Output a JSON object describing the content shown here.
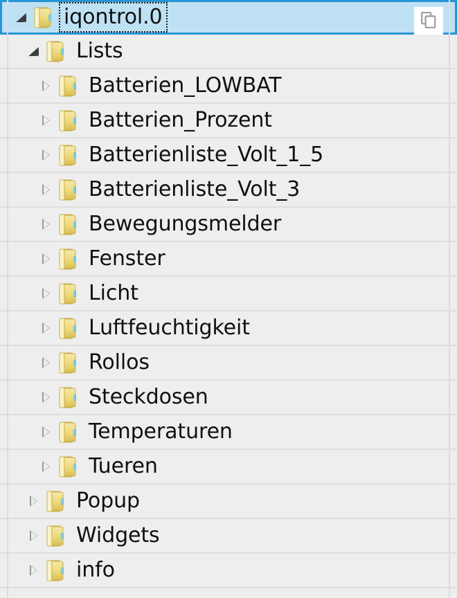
{
  "theme": {
    "row_background": "#eeeeee",
    "row_separator": "#dedede",
    "selection_fill": "#bfe1f4",
    "selection_border": "#2595d3",
    "folder_color": "#e8d36a",
    "text_color": "#101010",
    "arrow_collapsed_color": "#9a9a9a",
    "arrow_expanded_color": "#3d3d3d"
  },
  "tree": {
    "selected_row_index": 0,
    "rows": [
      {
        "label": "iqontrol.0",
        "level": 1,
        "state": "expanded",
        "selected": true,
        "focused": true,
        "has_copy_button": true
      },
      {
        "label": "Lists",
        "level": 2,
        "state": "expanded",
        "selected": false,
        "focused": false,
        "has_copy_button": false
      },
      {
        "label": "Batterien_LOWBAT",
        "level": 3,
        "state": "collapsed",
        "selected": false,
        "focused": false,
        "has_copy_button": false
      },
      {
        "label": "Batterien_Prozent",
        "level": 3,
        "state": "collapsed",
        "selected": false,
        "focused": false,
        "has_copy_button": false
      },
      {
        "label": "Batterienliste_Volt_1_5",
        "level": 3,
        "state": "collapsed",
        "selected": false,
        "focused": false,
        "has_copy_button": false
      },
      {
        "label": "Batterienliste_Volt_3",
        "level": 3,
        "state": "collapsed",
        "selected": false,
        "focused": false,
        "has_copy_button": false
      },
      {
        "label": "Bewegungsmelder",
        "level": 3,
        "state": "collapsed",
        "selected": false,
        "focused": false,
        "has_copy_button": false
      },
      {
        "label": "Fenster",
        "level": 3,
        "state": "collapsed",
        "selected": false,
        "focused": false,
        "has_copy_button": false
      },
      {
        "label": "Licht",
        "level": 3,
        "state": "collapsed",
        "selected": false,
        "focused": false,
        "has_copy_button": false
      },
      {
        "label": "Luftfeuchtigkeit",
        "level": 3,
        "state": "collapsed",
        "selected": false,
        "focused": false,
        "has_copy_button": false
      },
      {
        "label": "Rollos",
        "level": 3,
        "state": "collapsed",
        "selected": false,
        "focused": false,
        "has_copy_button": false
      },
      {
        "label": "Steckdosen",
        "level": 3,
        "state": "collapsed",
        "selected": false,
        "focused": false,
        "has_copy_button": false
      },
      {
        "label": "Temperaturen",
        "level": 3,
        "state": "collapsed",
        "selected": false,
        "focused": false,
        "has_copy_button": false
      },
      {
        "label": "Tueren",
        "level": 3,
        "state": "collapsed",
        "selected": false,
        "focused": false,
        "has_copy_button": false
      },
      {
        "label": "Popup",
        "level": 2,
        "state": "collapsed",
        "selected": false,
        "focused": false,
        "has_copy_button": false
      },
      {
        "label": "Widgets",
        "level": 2,
        "state": "collapsed",
        "selected": false,
        "focused": false,
        "has_copy_button": false
      },
      {
        "label": "info",
        "level": 2,
        "state": "collapsed",
        "selected": false,
        "focused": false,
        "has_copy_button": false
      }
    ]
  },
  "icons": {
    "folder": "folder-icon",
    "copy": "copy-icon",
    "expand_collapsed": "chevron-right-icon",
    "expand_expanded": "chevron-down-icon"
  },
  "copy_button": {
    "title": "Copy"
  }
}
